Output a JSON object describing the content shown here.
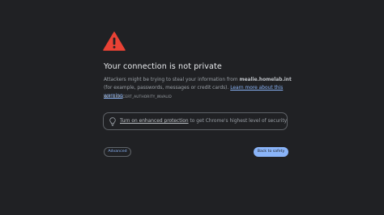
{
  "icons": {
    "warning": "warning-triangle-icon",
    "bulb": "lightbulb-icon"
  },
  "colors": {
    "background": "#202124",
    "warning_red": "#e94235",
    "link_blue": "#8ab4f8",
    "title_text": "#e8eaed",
    "body_text": "#9aa0a6"
  },
  "heading": "Your connection is not private",
  "description": {
    "prefix": "Attackers might be trying to steal your information from ",
    "host": "mealie.homelab.int",
    "suffix": " (for example, passwords, messages or credit cards). ",
    "learn_more": "Learn more about this warning"
  },
  "error_code": "NET::ERR_CERT_AUTHORITY_INVALID",
  "enhanced": {
    "link": "Turn on enhanced protection",
    "rest": " to get Chrome's highest level of security"
  },
  "buttons": {
    "advanced": "Advanced",
    "back": "Back to safety"
  }
}
